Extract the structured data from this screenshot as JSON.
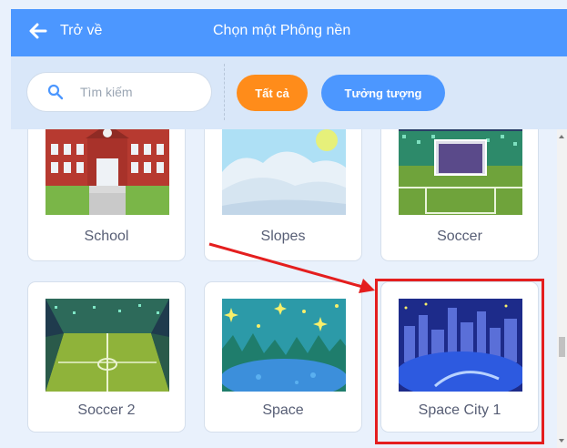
{
  "header": {
    "back_label": "Trở về",
    "title": "Chọn một Phông nền"
  },
  "filter": {
    "search_placeholder": "Tìm kiếm",
    "tags": [
      {
        "label": "Tất cả"
      },
      {
        "label": "Tưởng tượng"
      }
    ]
  },
  "backdrops": [
    {
      "name": "School"
    },
    {
      "name": "Slopes"
    },
    {
      "name": "Soccer"
    },
    {
      "name": "Soccer 2"
    },
    {
      "name": "Space"
    },
    {
      "name": "Space City 1"
    }
  ],
  "colors": {
    "header": "#4c97ff",
    "all_tag": "#ff8c1a",
    "category_tag": "#4c97ff",
    "annotation": "#e41e1e"
  },
  "annotation": {
    "highlighted_item": "Space City 1"
  }
}
